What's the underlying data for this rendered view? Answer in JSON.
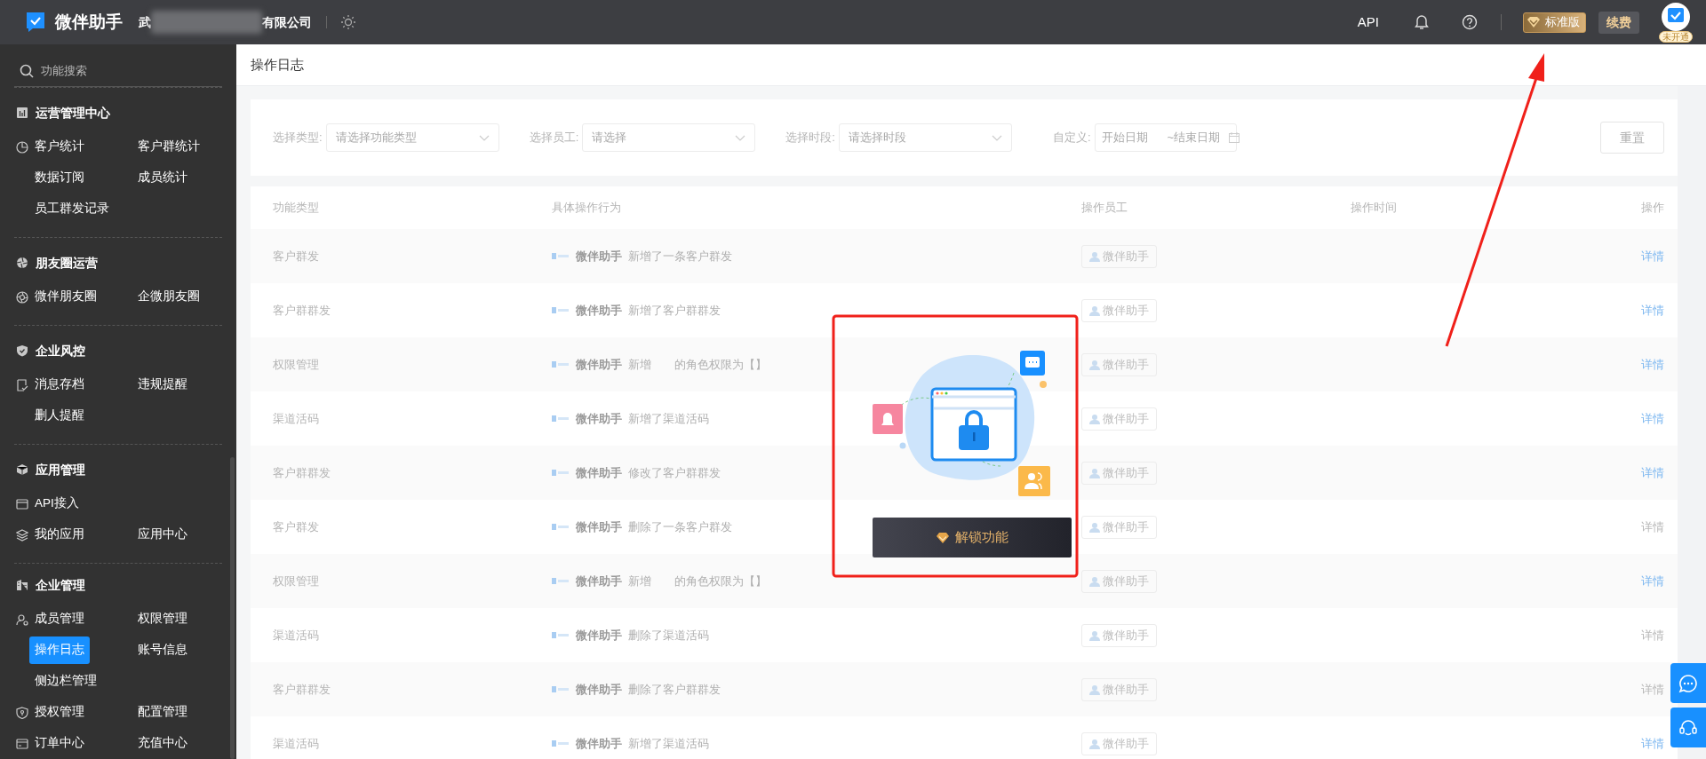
{
  "topbar": {
    "brand": "微伴助手",
    "company_prefix": "武",
    "company_suffix": "有限公司",
    "api": "API",
    "plan": "标准版",
    "renew": "续费",
    "avatar_badge": "未开通"
  },
  "sidebar": {
    "search_placeholder": "功能搜索",
    "sections": [
      {
        "title": "运营管理中心",
        "rows": [
          [
            {
              "label": "客户统计",
              "selected": false
            },
            {
              "label": "客户群统计",
              "selected": false
            }
          ],
          [
            {
              "label": "数据订阅",
              "selected": false
            },
            {
              "label": "成员统计",
              "selected": false
            }
          ],
          [
            {
              "label": "员工群发记录",
              "selected": false
            }
          ]
        ]
      },
      {
        "title": "朋友圈运营",
        "rows": [
          [
            {
              "label": "微伴朋友圈",
              "selected": false
            },
            {
              "label": "企微朋友圈",
              "selected": false
            }
          ]
        ]
      },
      {
        "title": "企业风控",
        "rows": [
          [
            {
              "label": "消息存档",
              "selected": false
            },
            {
              "label": "违规提醒",
              "selected": false
            }
          ],
          [
            {
              "label": "删人提醒",
              "selected": false
            }
          ]
        ]
      },
      {
        "title": "应用管理",
        "rows": [
          [
            {
              "label": "API接入",
              "selected": false
            }
          ],
          [
            {
              "label": "我的应用",
              "selected": false
            },
            {
              "label": "应用中心",
              "selected": false
            }
          ]
        ]
      },
      {
        "title": "企业管理",
        "rows": [
          [
            {
              "label": "成员管理",
              "selected": false
            },
            {
              "label": "权限管理",
              "selected": false
            }
          ],
          [
            {
              "label": "操作日志",
              "selected": true
            },
            {
              "label": "账号信息",
              "selected": false
            }
          ],
          [
            {
              "label": "侧边栏管理",
              "selected": false
            }
          ],
          [
            {
              "label": "授权管理",
              "selected": false
            },
            {
              "label": "配置管理",
              "selected": false
            }
          ],
          [
            {
              "label": "订单中心",
              "selected": false
            },
            {
              "label": "充值中心",
              "selected": false
            }
          ]
        ]
      }
    ]
  },
  "page_title": "操作日志",
  "filters": [
    {
      "label": "选择类型:",
      "placeholder": "请选择功能类型"
    },
    {
      "label": "选择员工:",
      "placeholder": "请选择"
    },
    {
      "label": "选择时段:",
      "placeholder": "请选择时段"
    }
  ],
  "date_range": {
    "label": "自定义:",
    "start_placeholder": "开始日期",
    "end_placeholder": "~结束日期"
  },
  "reset": "重置",
  "table": {
    "columns": [
      "功能类型",
      "具体操作行为",
      "操作员工",
      "操作时间",
      "操作"
    ],
    "rows": [
      {
        "type": "客户群发",
        "actor": "微伴助手",
        "action": "新增了一条客户群发",
        "operator": "微伴助手",
        "detail": "详情",
        "detail_enabled": true
      },
      {
        "type": "客户群群发",
        "actor": "微伴助手",
        "action": "新增了客户群群发",
        "operator": "微伴助手",
        "detail": "详情",
        "detail_enabled": true
      },
      {
        "type": "权限管理",
        "actor": "微伴助手",
        "action": "新增　　的角色权限为【】",
        "operator": "微伴助手",
        "detail": "详情",
        "detail_enabled": true
      },
      {
        "type": "渠道活码",
        "actor": "微伴助手",
        "action": "新增了渠道活码",
        "operator": "微伴助手",
        "detail": "详情",
        "detail_enabled": true
      },
      {
        "type": "客户群群发",
        "actor": "微伴助手",
        "action": "修改了客户群群发",
        "operator": "微伴助手",
        "detail": "详情",
        "detail_enabled": true
      },
      {
        "type": "客户群发",
        "actor": "微伴助手",
        "action": "删除了一条客户群发",
        "operator": "微伴助手",
        "detail": "详情",
        "detail_enabled": false
      },
      {
        "type": "权限管理",
        "actor": "微伴助手",
        "action": "新增　　的角色权限为【】",
        "operator": "微伴助手",
        "detail": "详情",
        "detail_enabled": true
      },
      {
        "type": "渠道活码",
        "actor": "微伴助手",
        "action": "删除了渠道活码",
        "operator": "微伴助手",
        "detail": "详情",
        "detail_enabled": false
      },
      {
        "type": "客户群群发",
        "actor": "微伴助手",
        "action": "删除了客户群群发",
        "operator": "微伴助手",
        "detail": "详情",
        "detail_enabled": false
      },
      {
        "type": "渠道活码",
        "actor": "微伴助手",
        "action": "新增了渠道活码",
        "operator": "微伴助手",
        "detail": "详情",
        "detail_enabled": true
      }
    ]
  },
  "lock_overlay": {
    "button": "解锁功能"
  }
}
